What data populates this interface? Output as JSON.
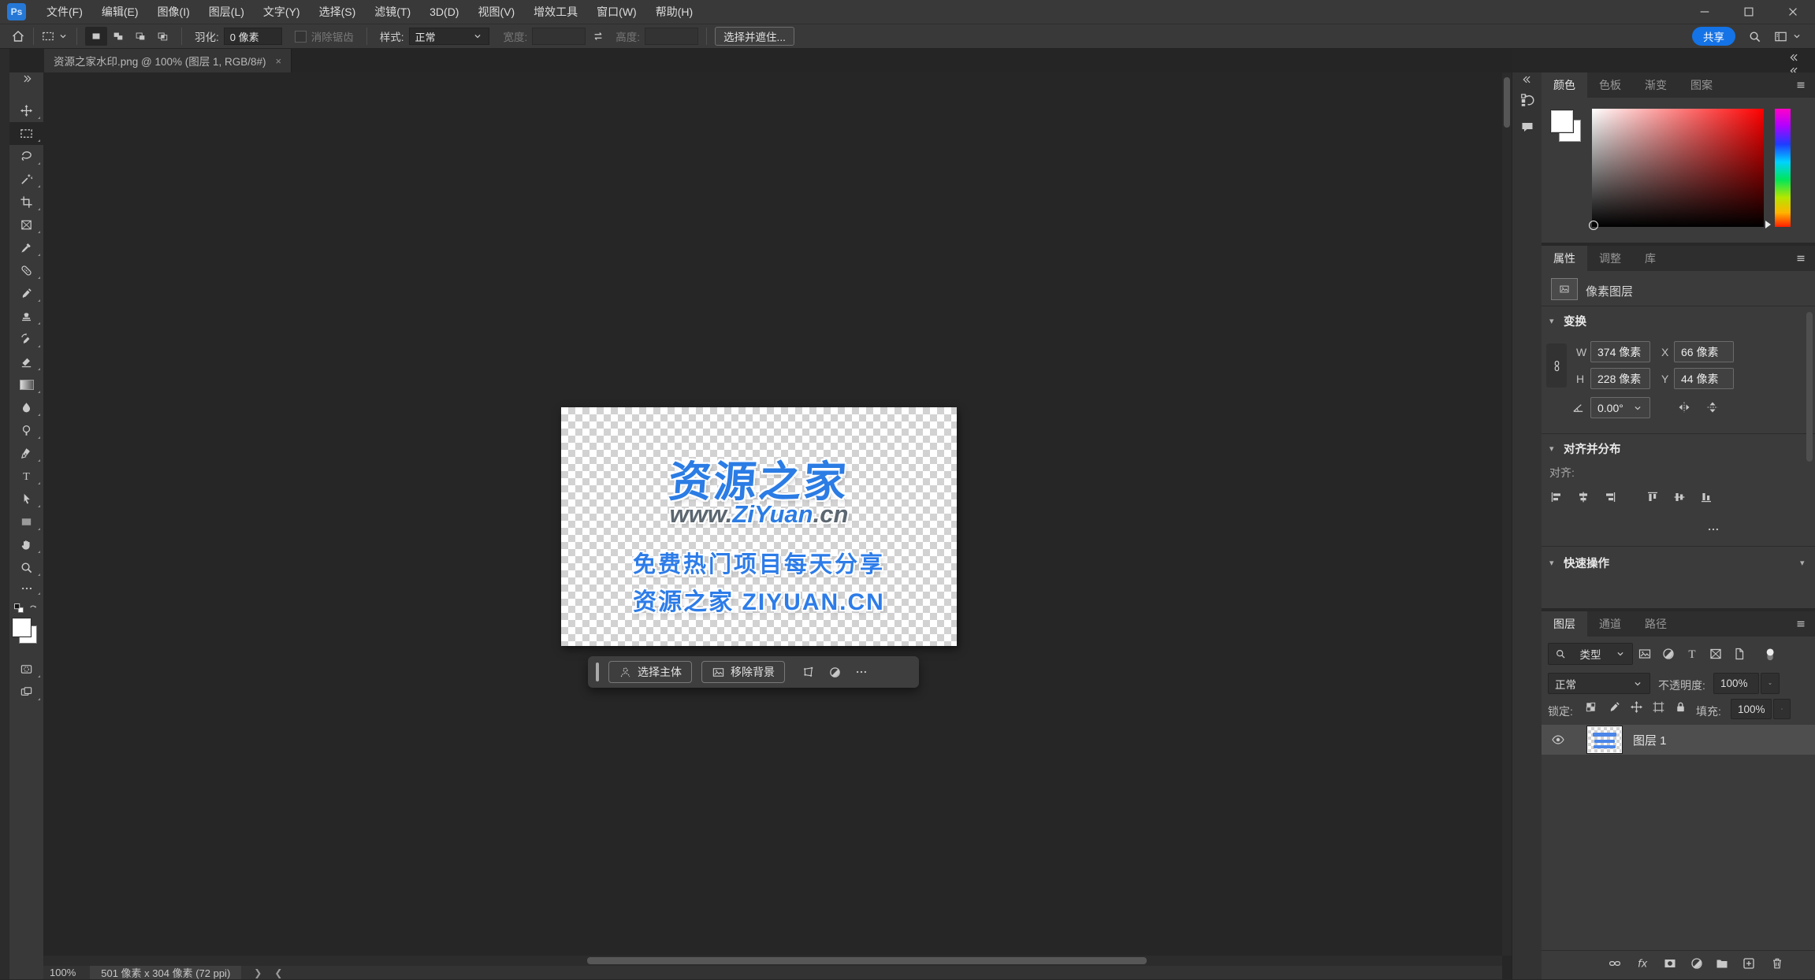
{
  "colors": {
    "accent_blue": "#1473e6",
    "watermark_blue": "#2b7ce4",
    "watermark_green": "#25c489",
    "watermark_gray": "#5b6670",
    "panel_bg": "#3b3b3b",
    "canvas_bg": "#262626"
  },
  "titlebar": {
    "logo": "Ps",
    "menu": [
      "文件(F)",
      "编辑(E)",
      "图像(I)",
      "图层(L)",
      "文字(Y)",
      "选择(S)",
      "滤镜(T)",
      "3D(D)",
      "视图(V)",
      "增效工具",
      "窗口(W)",
      "帮助(H)"
    ]
  },
  "options_bar": {
    "feather_label": "羽化:",
    "feather_value": "0 像素",
    "anti_alias": "消除锯齿",
    "style_label": "样式:",
    "style_value": "正常",
    "width_label": "宽度:",
    "height_label": "高度:",
    "select_and_mask": "选择并遮住...",
    "share": "共享"
  },
  "tab": {
    "title": "资源之家水印.png @ 100% (图层 1, RGB/8#)",
    "close": "×"
  },
  "watermark": {
    "line1": "资源之家",
    "line2_prefix": "www.",
    "line2_domain": "ZiYuan",
    "line2_suffix": ".cn",
    "line3": "免费热门项目每天分享",
    "line4": "资源之家 ZIYUAN.CN"
  },
  "context_bar": {
    "select_subject": "选择主体",
    "remove_background": "移除背景"
  },
  "panels": {
    "color": {
      "tabs": [
        "颜色",
        "色板",
        "渐变",
        "图案"
      ]
    },
    "properties": {
      "tabs": [
        "属性",
        "调整",
        "库"
      ],
      "layer_type": "像素图层",
      "transform_header": "变换",
      "w_label": "W",
      "w_value": "374 像素",
      "x_label": "X",
      "x_value": "66 像素",
      "h_label": "H",
      "h_value": "228 像素",
      "y_label": "Y",
      "y_value": "44 像素",
      "angle_value": "0.00°",
      "align_header": "对齐并分布",
      "align_label": "对齐:",
      "quick_header": "快速操作"
    },
    "layers": {
      "tabs": [
        "图层",
        "通道",
        "路径"
      ],
      "filter_type": "类型",
      "blend_mode": "正常",
      "opacity_label": "不透明度:",
      "opacity_value": "100%",
      "lock_label": "锁定:",
      "fill_label": "填充:",
      "fill_value": "100%",
      "layer_name": "图层 1",
      "fx": "fx"
    }
  },
  "status_bar": {
    "zoom": "100%",
    "doc_info": "501 像素 x 304 像素 (72 ppi)"
  }
}
